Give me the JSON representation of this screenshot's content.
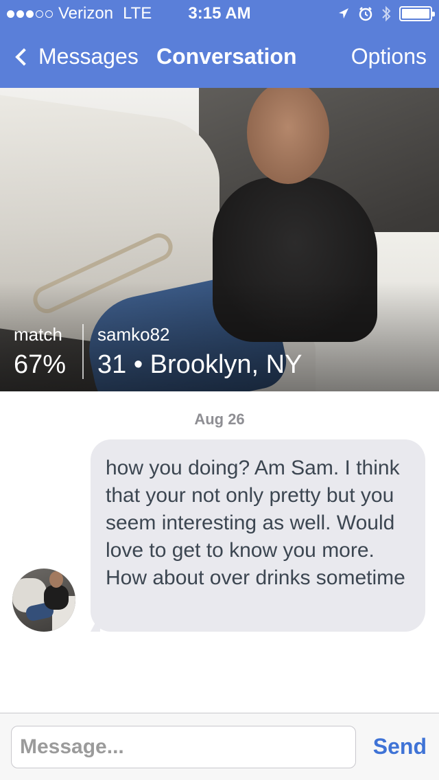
{
  "status_bar": {
    "carrier": "Verizon",
    "network": "LTE",
    "time": "3:15 AM",
    "signal_bars_filled": 3,
    "signal_bars_total": 5,
    "icons": [
      "location-arrow-icon",
      "alarm-icon",
      "bluetooth-icon",
      "battery-icon"
    ]
  },
  "nav": {
    "back_label": "Messages",
    "title": "Conversation",
    "options_label": "Options"
  },
  "profile": {
    "match_label": "match",
    "match_value": "67%",
    "username": "samko82",
    "age_location": "31 • Brooklyn, NY"
  },
  "conversation": {
    "date": "Aug 26",
    "messages": [
      {
        "text": "how you doing? Am Sam. I think that your not only pretty but you seem interesting as well. Would love to get to know you more. How about over drinks sometime"
      }
    ]
  },
  "compose": {
    "placeholder": "Message...",
    "send_label": "Send"
  },
  "colors": {
    "accent": "#5a7fd9",
    "send": "#3f73d6",
    "bubble": "#e9e9ee"
  }
}
